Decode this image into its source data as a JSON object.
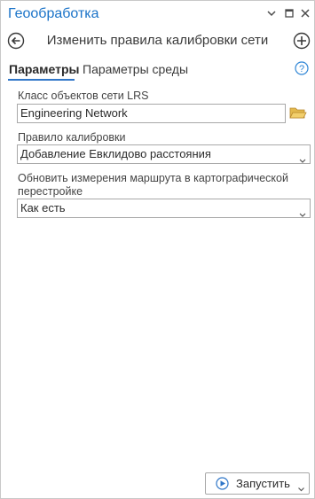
{
  "window": {
    "title": "Геообработка",
    "pin_icon": "chevron-down-icon",
    "restore_icon": "restore-icon",
    "close_icon": "close-icon"
  },
  "header": {
    "tool_title": "Изменить правила калибровки сети",
    "back_icon": "back-arrow-icon",
    "add_icon": "add-icon"
  },
  "tabs": [
    {
      "label": "Параметры",
      "active": true
    },
    {
      "label": "Параметры среды",
      "active": false
    }
  ],
  "help_icon": "help-icon",
  "params": {
    "network_class": {
      "label": "Класс объектов сети LRS",
      "value": "Engineering Network"
    },
    "calibration_rule": {
      "label": "Правило калибровки",
      "value": "Добавление Евклидово расстояния"
    },
    "update_measures": {
      "label_line1": "Обновить измерения маршрута в картографической",
      "label_line2": "перестройке",
      "value": "Как есть"
    }
  },
  "run_button": {
    "label": "Запустить"
  },
  "colors": {
    "accent": "#1a73c8",
    "folder": "#e3b94d"
  }
}
